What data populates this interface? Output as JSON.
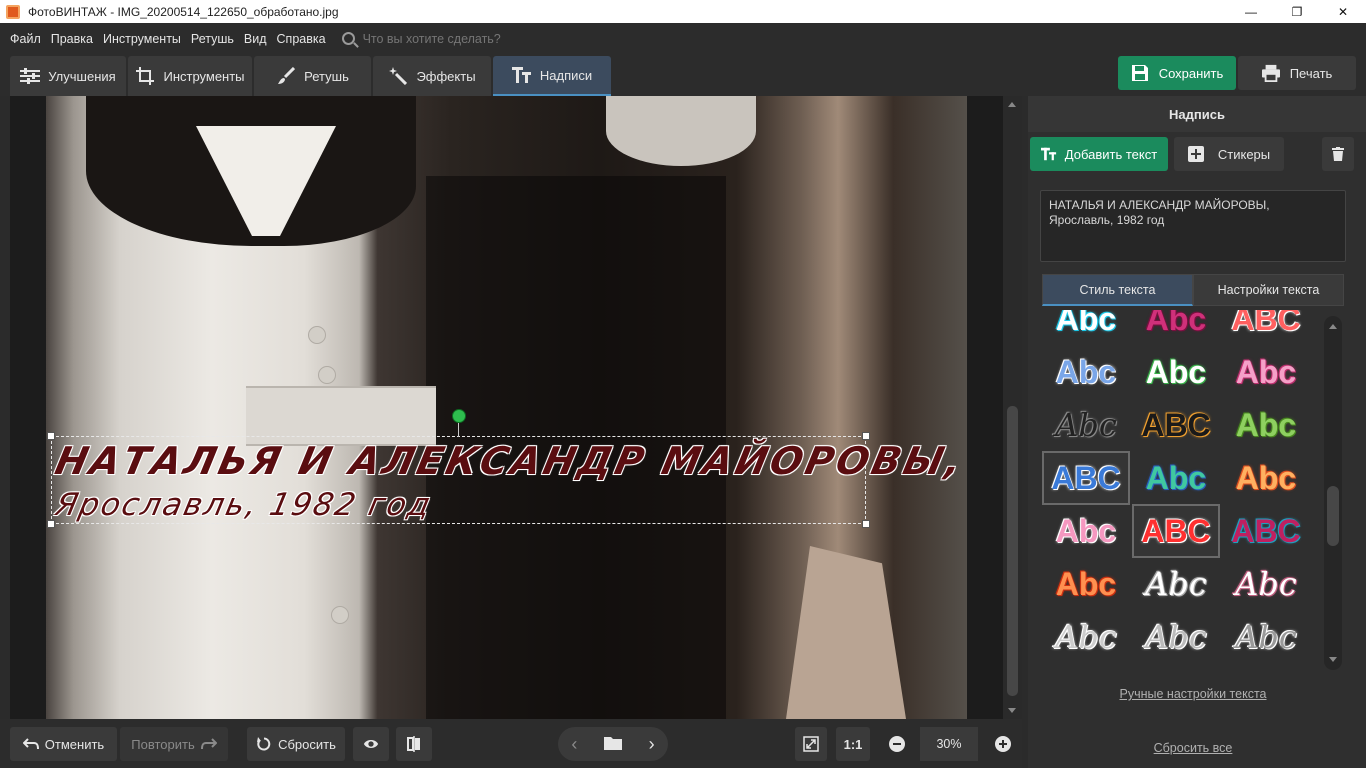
{
  "window": {
    "title": "ФотоВИНТАЖ - IMG_20200514_122650_обработано.jpg",
    "minimize": "—",
    "maximize": "❐",
    "close": "✕"
  },
  "menu": {
    "items": [
      "Файл",
      "Правка",
      "Инструменты",
      "Ретушь",
      "Вид",
      "Справка"
    ],
    "search_placeholder": "Что вы хотите сделать?"
  },
  "toolbar": {
    "tabs": [
      {
        "label": "Улучшения",
        "icon": "sliders-icon"
      },
      {
        "label": "Инструменты",
        "icon": "crop-icon"
      },
      {
        "label": "Ретушь",
        "icon": "brush-icon"
      },
      {
        "label": "Эффекты",
        "icon": "magic-wand-icon"
      },
      {
        "label": "Надписи",
        "icon": "text-icon",
        "active": true
      }
    ],
    "save_label": "Сохранить",
    "print_label": "Печать"
  },
  "canvas": {
    "caption_line1": "НАТАЛЬЯ И АЛЕКСАНДР МАЙОРОВЫ,",
    "caption_line2": "Ярославль, 1982 год"
  },
  "bottombar": {
    "undo_label": "Отменить",
    "redo_label": "Повторить",
    "reset_label": "Сбросить",
    "ratio_label": "1:1",
    "zoom_value": "30%"
  },
  "panel": {
    "header": "Надпись",
    "add_text_label": "Добавить текст",
    "stickers_label": "Стикеры",
    "text_value": "НАТАЛЬЯ И АЛЕКСАНДР МАЙОРОВЫ,\nЯрославль, 1982 год",
    "style_tab_label": "Стиль текста",
    "settings_tab_label": "Настройки текста",
    "manual_settings_link": "Ручные настройки текста",
    "reset_all_link": "Сбросить все"
  },
  "styles": [
    {
      "text": "Abc",
      "color": "#ffffff",
      "glow": "#1ec8e8"
    },
    {
      "text": "Abc",
      "color": "#d0307a",
      "glow": "#7a1040"
    },
    {
      "text": "ABC",
      "color": "#ff6060",
      "glow": "#ffffff"
    },
    {
      "text": "Abc",
      "color": "#7aa6e8",
      "glow": "#ffffff"
    },
    {
      "text": "Abc",
      "color": "#ffffff",
      "glow": "#3ab34a"
    },
    {
      "text": "Abc",
      "color": "#f5a0c8",
      "glow": "#c03070"
    },
    {
      "text": "Abc",
      "color": "#222222",
      "glow": "#888888"
    },
    {
      "text": "ABC",
      "color": "#1a1a1a",
      "glow": "#f0a030"
    },
    {
      "text": "Abc",
      "color": "#8ed060",
      "glow": "#4a8a20"
    },
    {
      "text": "ABC",
      "color": "#3a7ad8",
      "glow": "#ffffff",
      "selected": true
    },
    {
      "text": "Abc",
      "color": "#40c8a0",
      "glow": "#2a60c0"
    },
    {
      "text": "Abc",
      "color": "#ffb060",
      "glow": "#e05020"
    },
    {
      "text": "Abc",
      "color": "#f598c0",
      "glow": "#ffffff"
    },
    {
      "text": "ABC",
      "color": "#ff3030",
      "glow": "#ffffff",
      "selected": true
    },
    {
      "text": "ABC",
      "color": "#c02060",
      "glow": "#20a0c0"
    },
    {
      "text": "Abc",
      "color": "#ff9050",
      "glow": "#d03010"
    },
    {
      "text": "Abc",
      "color": "#ffffff",
      "glow": "#aaaaaa"
    },
    {
      "text": "Abc",
      "color": "#ffffff",
      "glow": "#c06080"
    },
    {
      "text": "Abc",
      "color": "#cccccc",
      "glow": "#ffffff"
    },
    {
      "text": "Abc",
      "color": "#bbbbbb",
      "glow": "#ffffff"
    },
    {
      "text": "Abc",
      "color": "#999999",
      "glow": "#ffffff"
    }
  ],
  "colors": {
    "accent_green": "#1b8b5d",
    "tab_active": "#3c4b5e",
    "tab_underline": "#4a90c2"
  }
}
